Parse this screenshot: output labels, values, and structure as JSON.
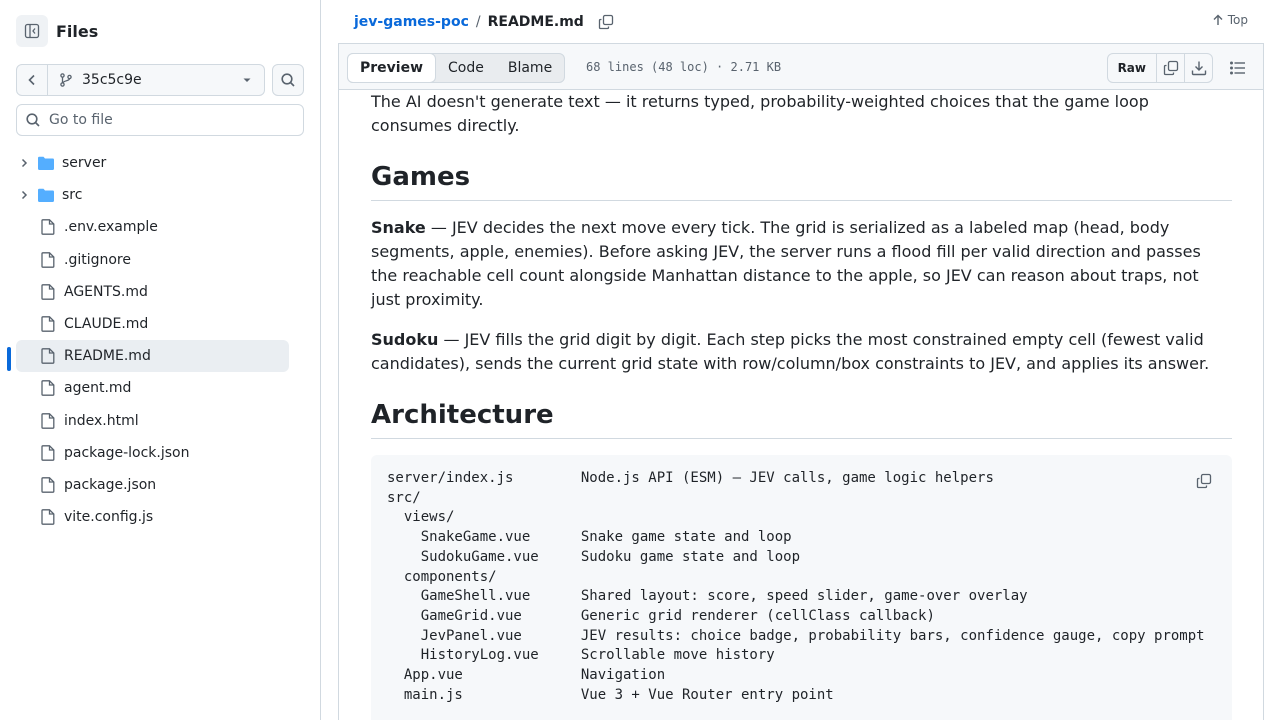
{
  "sidebar": {
    "title": "Files",
    "branch": "35c5c9e",
    "search_placeholder": "Go to file",
    "items": [
      {
        "name": "server",
        "type": "folder"
      },
      {
        "name": "src",
        "type": "folder"
      },
      {
        "name": ".env.example",
        "type": "file"
      },
      {
        "name": ".gitignore",
        "type": "file"
      },
      {
        "name": "AGENTS.md",
        "type": "file"
      },
      {
        "name": "CLAUDE.md",
        "type": "file"
      },
      {
        "name": "README.md",
        "type": "file",
        "selected": true
      },
      {
        "name": "agent.md",
        "type": "file"
      },
      {
        "name": "index.html",
        "type": "file"
      },
      {
        "name": "package-lock.json",
        "type": "file"
      },
      {
        "name": "package.json",
        "type": "file"
      },
      {
        "name": "vite.config.js",
        "type": "file"
      }
    ]
  },
  "header": {
    "repo": "jev-games-poc",
    "separator": "/",
    "file": "README.md",
    "top_label": "Top"
  },
  "toolbar": {
    "tabs": [
      "Preview",
      "Code",
      "Blame"
    ],
    "meta": "68 lines (48 loc) · 2.71 KB",
    "raw_label": "Raw"
  },
  "readme": {
    "intro": "The AI doesn't generate text — it returns typed, probability-weighted choices that the game loop consumes directly.",
    "games_heading": "Games",
    "snake_title": "Snake",
    "snake_text": " — JEV decides the next move every tick. The grid is serialized as a labeled map (head, body segments, apple, enemies). Before asking JEV, the server runs a flood fill per valid direction and passes the reachable cell count alongside Manhattan distance to the apple, so JEV can reason about traps, not just proximity.",
    "sudoku_title": "Sudoku",
    "sudoku_text": " — JEV fills the grid digit by digit. Each step picks the most constrained empty cell (fewest valid candidates), sends the current grid state with row/column/box constraints to JEV, and applies its answer.",
    "arch_heading": "Architecture",
    "code": "server/index.js        Node.js API (ESM) — JEV calls, game logic helpers\nsrc/\n  views/\n    SnakeGame.vue      Snake game state and loop\n    SudokuGame.vue     Sudoku game state and loop\n  components/\n    GameShell.vue      Shared layout: score, speed slider, game-over overlay\n    GameGrid.vue       Generic grid renderer (cellClass callback)\n    JevPanel.vue       JEV results: choice badge, probability bars, confidence gauge, copy prompt\n    HistoryLog.vue     Scrollable move history\n  App.vue              Navigation\n  main.js              Vue 3 + Vue Router entry point"
  },
  "colors": {
    "accent": "#0969da",
    "folder": "#54aeff",
    "border": "#d1d9e0",
    "muted": "#59636e"
  }
}
